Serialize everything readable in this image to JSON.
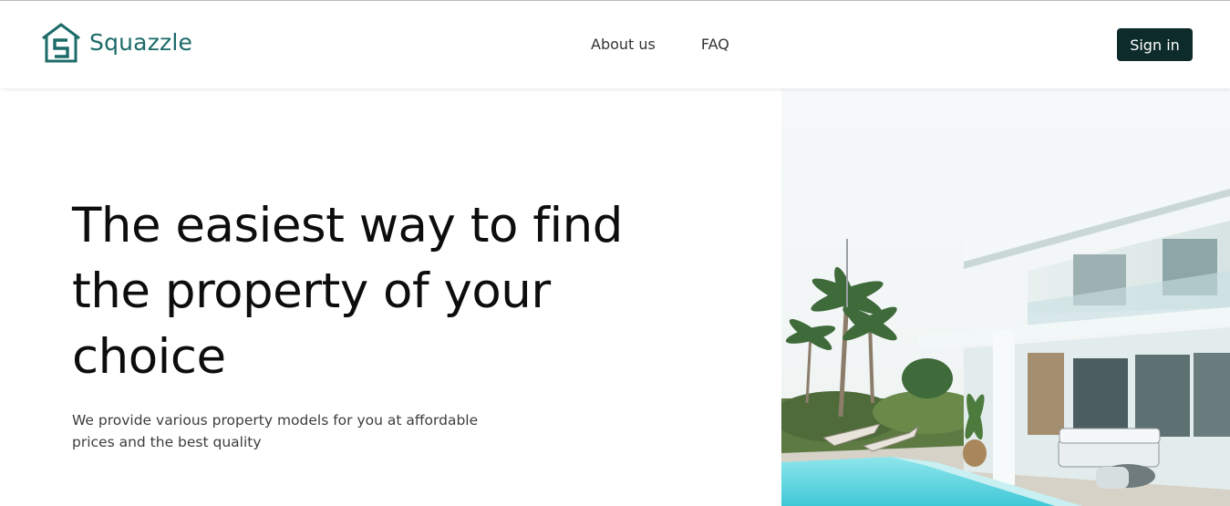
{
  "header": {
    "brand": "Squazzle",
    "nav": [
      {
        "label": "About us"
      },
      {
        "label": "FAQ"
      }
    ],
    "sign_in_label": "Sign in"
  },
  "hero": {
    "title": "The easiest way to find the property of your choice",
    "subtitle": "We provide various property models for you at affordable prices and the best quality"
  },
  "colors": {
    "brand": "#1c6b69",
    "button": "#0e2b2b",
    "pool": "#54d6e0"
  },
  "icons": {
    "logo": "house-s-logo-icon"
  }
}
